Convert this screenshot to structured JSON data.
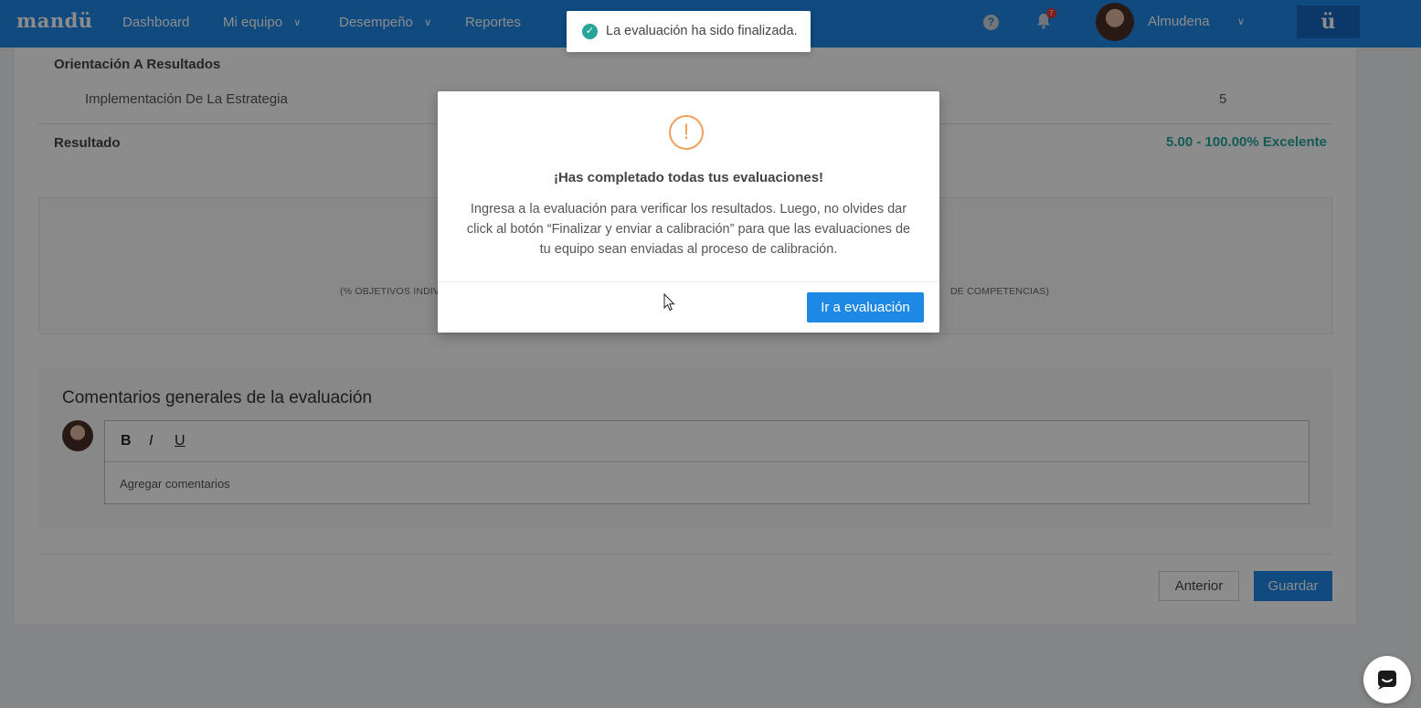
{
  "navbar": {
    "logo": "mandü",
    "dashboard": "Dashboard",
    "team": "Mi equipo",
    "performance": "Desempeño",
    "reports": "Reportes",
    "help_glyph": "?",
    "notifications_count": "7",
    "user_name": "Almudena",
    "brand_glyph": "ü",
    "chevron_glyph": "∨",
    "accent_color": "#1e88e5"
  },
  "evaluation": {
    "section_heading": "Orientación A Resultados",
    "item_label": "Implementación De La Estrategia",
    "item_value": "5",
    "result_label": "Resultado",
    "result_value": "5.00 - 100.00% Excelente",
    "result_color": "#26a69a",
    "score_left_label": "(% OBJETIVOS INDIV",
    "score_right_label": "DE COMPETENCIAS)"
  },
  "comments": {
    "title": "Comentarios generales de la evaluación",
    "bold": "B",
    "italic": "I",
    "underline": "U",
    "placeholder": "Agregar comentarios"
  },
  "footer": {
    "previous": "Anterior",
    "save": "Guardar"
  },
  "toast": {
    "icon_glyph": "✓",
    "message": "La evaluación ha sido finalizada."
  },
  "modal": {
    "icon_glyph": "!",
    "icon_color": "#f0a05a",
    "title": "¡Has completado todas tus evaluaciones!",
    "body": "Ingresa a la evaluación para verificar los resultados. Luego, no olvides dar click al botón “Finalizar y enviar a calibración” para que las evaluaciones de tu equipo sean enviadas al proceso de calibración.",
    "button": "Ir a evaluación"
  }
}
